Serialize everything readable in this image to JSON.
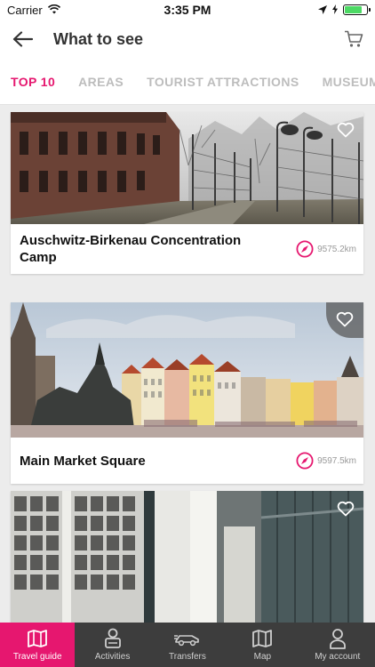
{
  "status": {
    "carrier": "Carrier",
    "time": "3:35 PM",
    "battery_level": 0.8
  },
  "header": {
    "title": "What to see"
  },
  "tabs": [
    "TOP 10",
    "AREAS",
    "TOURIST ATTRACTIONS",
    "MUSEUMS"
  ],
  "active_tab": "TOP 10",
  "cards": [
    {
      "title": "Auschwitz-Birkenau Concentration Camp",
      "distance": "9575.2km"
    },
    {
      "title": "Main Market Square",
      "distance": "9597.5km"
    },
    {
      "title": "",
      "distance": ""
    }
  ],
  "nav": {
    "items": [
      "Travel guide",
      "Activities",
      "Transfers",
      "Map",
      "My account"
    ],
    "active": "Travel guide"
  },
  "colors": {
    "accent": "#e6176f",
    "nav_bg": "#3d3d3d"
  }
}
